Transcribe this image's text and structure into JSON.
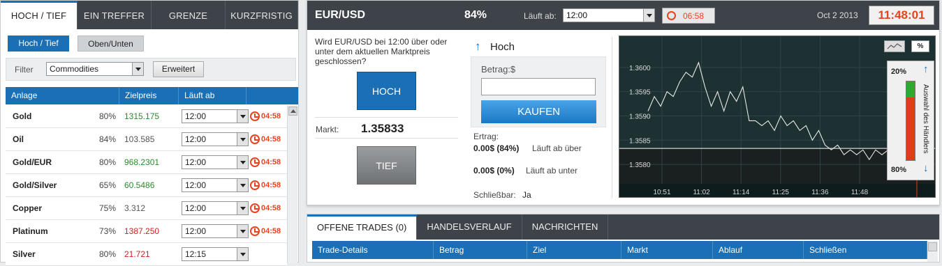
{
  "left": {
    "tabs": [
      "HOCH / TIEF",
      "EIN TREFFER",
      "GRENZE",
      "KURZFRISTIG"
    ],
    "pills": [
      "Hoch / Tief",
      "Oben/Unten"
    ],
    "filter": {
      "label": "Filter",
      "value": "Commodities",
      "advanced": "Erweitert"
    },
    "columns": [
      "Anlage",
      "Zielpreis",
      "Läuft ab"
    ],
    "rows": [
      {
        "name": "Gold",
        "pct": "80%",
        "price": "1315.175",
        "price_color": "#2a8a2a",
        "expiry": "12:00",
        "time": "04:58"
      },
      {
        "name": "Oil",
        "pct": "84%",
        "price": "103.585",
        "price_color": "#555555",
        "expiry": "12:00",
        "time": "04:58"
      },
      {
        "name": "Gold/EUR",
        "pct": "80%",
        "price": "968.2301",
        "price_color": "#2a8a2a",
        "expiry": "12:00",
        "time": "04:58"
      },
      {
        "name": "Gold/Silver",
        "pct": "65%",
        "price": "60.5486",
        "price_color": "#2a8a2a",
        "expiry": "12:00",
        "time": "04:58"
      },
      {
        "name": "Copper",
        "pct": "75%",
        "price": "3.312",
        "price_color": "#555555",
        "expiry": "12:00",
        "time": "04:58"
      },
      {
        "name": "Platinum",
        "pct": "73%",
        "price": "1387.250",
        "price_color": "#d02020",
        "expiry": "12:00",
        "time": "04:58"
      },
      {
        "name": "Silver",
        "pct": "80%",
        "price": "21.721",
        "price_color": "#d02020",
        "expiry": "12:15",
        "time": ""
      }
    ]
  },
  "trade": {
    "pair": "EUR/USD",
    "percent": "84%",
    "expiry_label": "Läuft ab:",
    "expiry_value": "12:00",
    "countdown": "06:58",
    "date": "Oct 2 2013",
    "clock": "11:48:01",
    "question": "Wird EUR/USD bei 12:00 über oder unter dem aktuellen Marktpreis geschlossen?",
    "high_button": "HOCH",
    "low_button": "TIEF",
    "market_label": "Markt:",
    "market_value": "1.35833",
    "direction": "Hoch",
    "amount_label": "Betrag:$",
    "amount_value": "",
    "buy_button": "KAUFEN",
    "yield_label": "Ertrag:",
    "yield_above_value": "0.00$ (84%)",
    "yield_above_text": "Läuft ab über",
    "yield_below_value": "0.00$ (0%)",
    "yield_below_text": "Läuft ab unter",
    "closable_label": "Schließbar:",
    "closable_value": "Ja",
    "sentiment_title": "Auswahl des Händlers",
    "sentiment_up": "20%",
    "sentiment_down": "80%",
    "pct_button": "%"
  },
  "chart_data": {
    "type": "line",
    "ylim": [
      1.3576,
      1.3605
    ],
    "yticks": [
      "1.3600",
      "1.3595",
      "1.3590",
      "1.3585",
      "1.3580"
    ],
    "xticks": [
      "10:51",
      "11:02",
      "11:14",
      "11:25",
      "11:36",
      "11:48"
    ],
    "current": 1.35833,
    "series": [
      {
        "values": [
          1.3591,
          1.3594,
          1.3592,
          1.3595,
          1.3594,
          1.3597,
          1.3599,
          1.3598,
          1.3601,
          1.3596,
          1.3592,
          1.3595,
          1.3591,
          1.3595,
          1.3593,
          1.3596,
          1.3589,
          1.3589,
          1.3588,
          1.3589,
          1.3587,
          1.359,
          1.3588,
          1.3589,
          1.3587,
          1.3588,
          1.3585,
          1.3587,
          1.3584,
          1.3583,
          1.3584,
          1.3582,
          1.3583,
          1.3582,
          1.3583,
          1.3581,
          1.3583,
          1.3582,
          1.3583
        ]
      }
    ]
  },
  "bottom": {
    "tabs": [
      "OFFENE TRADES (0)",
      "HANDELSVERLAUF",
      "NACHRICHTEN"
    ],
    "columns": [
      "Trade-Details",
      "Betrag",
      "Ziel",
      "Markt",
      "Ablauf",
      "Schließen"
    ]
  }
}
